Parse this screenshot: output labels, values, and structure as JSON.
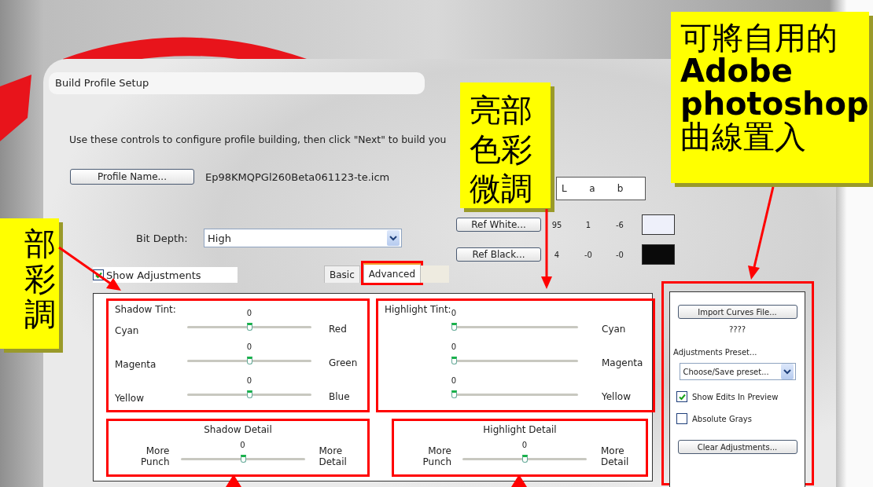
{
  "dialog": {
    "title": "Build Profile Setup",
    "instructions": "Use these controls to configure profile building, then click \"Next\" to build you",
    "profile_button": "Profile Name...",
    "profile_file": "Ep98KMQPGl260Beta061123-te.icm",
    "lab_headers": [
      "L",
      "a",
      "b"
    ],
    "references": [
      {
        "button": "Ref White...",
        "L": "95",
        "a": "1",
        "b": "-6",
        "color": "#eef0fa"
      },
      {
        "button": "Ref Black...",
        "L": "4",
        "a": "-0",
        "b": "-0",
        "color": "#0a0a0a"
      }
    ],
    "bit_depth": {
      "label": "Bit Depth:",
      "value": "High"
    },
    "show_adjustments": {
      "label": "Show Adjustments",
      "checked": true
    },
    "tabs": [
      {
        "label": "Basic",
        "selected": false
      },
      {
        "label": "Advanced",
        "selected": true
      }
    ],
    "shadow_tint": {
      "title": "Shadow Tint:",
      "sliders": [
        {
          "value": "0",
          "left": "Cyan",
          "right": "Red",
          "level": 0.5
        },
        {
          "value": "0",
          "left": "Magenta",
          "right": "Green",
          "level": 0.5
        },
        {
          "value": "0",
          "left": "Yellow",
          "right": "Blue",
          "level": 0.5
        }
      ]
    },
    "highlight_tint": {
      "title": "Highlight Tint:",
      "sliders": [
        {
          "value": "0",
          "right": "Cyan",
          "level": 0
        },
        {
          "value": "0",
          "right": "Magenta",
          "level": 0
        },
        {
          "value": "0",
          "right": "Yellow",
          "level": 0
        }
      ]
    },
    "shadow_detail": {
      "title": "Shadow Detail",
      "value": "0",
      "left": "More Punch",
      "right": "More Detail",
      "level": 0.5
    },
    "highlight_detail": {
      "title": "Highlight Detail",
      "value": "0",
      "left": "More Punch",
      "right": "More Detail",
      "level": 0.5
    },
    "side_panel": {
      "import_button": "Import Curves File...",
      "curves_file": "????",
      "preset_label": "Adjustments Preset...",
      "preset_value": "Choose/Save preset...",
      "checkboxes": [
        {
          "label": "Show Edits In Preview",
          "checked": true
        },
        {
          "label": "Absolute Grays",
          "checked": false
        }
      ],
      "clear_button": "Clear Adjustments..."
    }
  },
  "callouts": [
    {
      "lines": [
        "部",
        "彩",
        "調"
      ]
    },
    {
      "lines": [
        "亮部",
        "色彩",
        "微調"
      ]
    },
    {
      "lines": [
        "可將自用的",
        "**Adobe photoshop**",
        "曲線置入"
      ]
    }
  ]
}
